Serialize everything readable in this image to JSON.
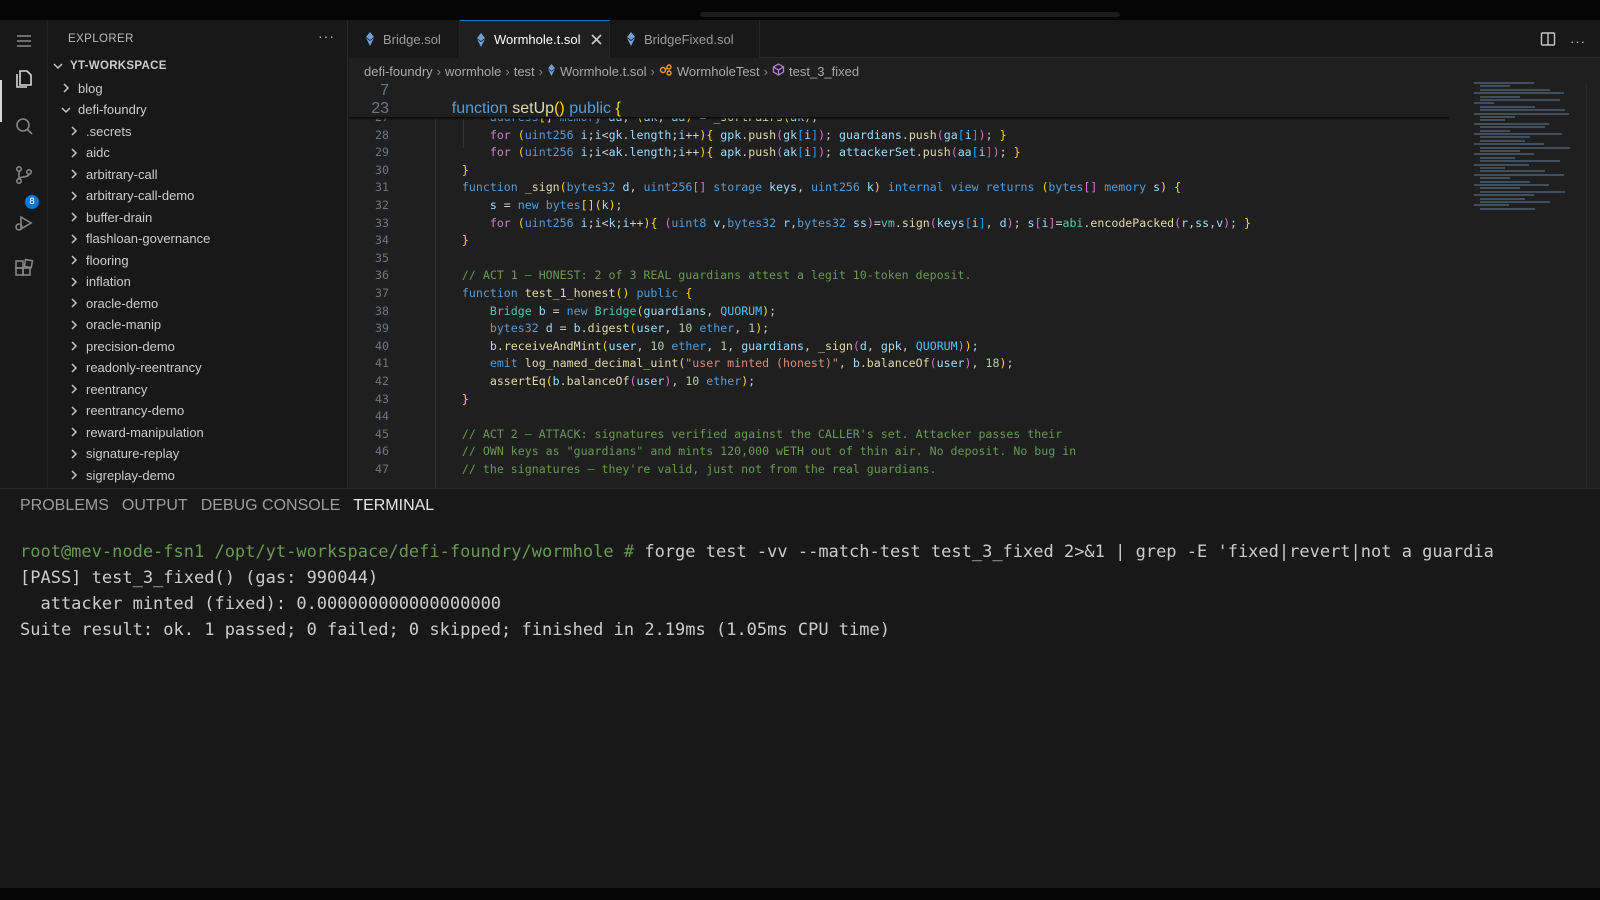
{
  "sidebar": {
    "title": "EXPLORER",
    "more": "···",
    "workspace": "YT-WORKSPACE",
    "items": [
      {
        "label": "blog",
        "indent": 1
      },
      {
        "label": "defi-foundry",
        "indent": 1,
        "open": true
      },
      {
        "label": ".secrets",
        "indent": 2
      },
      {
        "label": "aidc",
        "indent": 2
      },
      {
        "label": "arbitrary-call",
        "indent": 2
      },
      {
        "label": "arbitrary-call-demo",
        "indent": 2
      },
      {
        "label": "buffer-drain",
        "indent": 2
      },
      {
        "label": "flashloan-governance",
        "indent": 2
      },
      {
        "label": "flooring",
        "indent": 2
      },
      {
        "label": "inflation",
        "indent": 2
      },
      {
        "label": "oracle-demo",
        "indent": 2
      },
      {
        "label": "oracle-manip",
        "indent": 2
      },
      {
        "label": "precision-demo",
        "indent": 2
      },
      {
        "label": "readonly-reentrancy",
        "indent": 2
      },
      {
        "label": "reentrancy",
        "indent": 2
      },
      {
        "label": "reentrancy-demo",
        "indent": 2
      },
      {
        "label": "reward-manipulation",
        "indent": 2
      },
      {
        "label": "signature-replay",
        "indent": 2
      },
      {
        "label": "sigreplay-demo",
        "indent": 2
      }
    ]
  },
  "activity": {
    "scm_badge": "8"
  },
  "tabs": [
    {
      "label": "Bridge.sol",
      "active": false
    },
    {
      "label": "Wormhole.t.sol",
      "active": true
    },
    {
      "label": "BridgeFixed.sol",
      "active": false
    }
  ],
  "tab_actions": {
    "more": "···"
  },
  "breadcrumb": [
    "defi-foundry",
    "wormhole",
    "test",
    "Wormhole.t.sol",
    "WormholeTest",
    "test_3_fixed"
  ],
  "sticky_lines": [
    {
      "n": "7",
      "code": ""
    },
    {
      "n": "23",
      "code": "    function setUp() public {"
    }
  ],
  "code_lines": [
    {
      "n": "27",
      "code": "        address[] memory aa; (ak, aa) = _sortPairs(ak);"
    },
    {
      "n": "28",
      "code": "        for (uint256 i;i<gk.length;i++){ gpk.push(gk[i]); guardians.push(ga[i]); }"
    },
    {
      "n": "29",
      "code": "        for (uint256 i;i<ak.length;i++){ apk.push(ak[i]); attackerSet.push(aa[i]); }"
    },
    {
      "n": "30",
      "code": "    }"
    },
    {
      "n": "31",
      "code": "    function _sign(bytes32 d, uint256[] storage keys, uint256 k) internal view returns (bytes[] memory s) {"
    },
    {
      "n": "32",
      "code": "        s = new bytes[](k);"
    },
    {
      "n": "33",
      "code": "        for (uint256 i;i<k;i++){ (uint8 v,bytes32 r,bytes32 ss)=vm.sign(keys[i], d); s[i]=abi.encodePacked(r,ss,v); }"
    },
    {
      "n": "34",
      "code": "    }"
    },
    {
      "n": "35",
      "code": ""
    },
    {
      "n": "36",
      "code": "    // ACT 1 — HONEST: 2 of 3 REAL guardians attest a legit 10-token deposit."
    },
    {
      "n": "37",
      "code": "    function test_1_honest() public {"
    },
    {
      "n": "38",
      "code": "        Bridge b = new Bridge(guardians, QUORUM);"
    },
    {
      "n": "39",
      "code": "        bytes32 d = b.digest(user, 10 ether, 1);"
    },
    {
      "n": "40",
      "code": "        b.receiveAndMint(user, 10 ether, 1, guardians, _sign(d, gpk, QUORUM));"
    },
    {
      "n": "41",
      "code": "        emit log_named_decimal_uint(\"user minted (honest)\", b.balanceOf(user), 18);"
    },
    {
      "n": "42",
      "code": "        assertEq(b.balanceOf(user), 10 ether);"
    },
    {
      "n": "43",
      "code": "    }"
    },
    {
      "n": "44",
      "code": ""
    },
    {
      "n": "45",
      "code": "    // ACT 2 — ATTACK: signatures verified against the CALLER's set. Attacker passes their"
    },
    {
      "n": "46",
      "code": "    // OWN keys as \"guardians\" and mints 120,000 wETH out of thin air. No deposit. No bug in"
    },
    {
      "n": "47",
      "code": "    // the signatures — they're valid, just not from the real guardians."
    }
  ],
  "panel": {
    "tabs": [
      {
        "label": "PROBLEMS",
        "active": false
      },
      {
        "label": "OUTPUT",
        "active": false
      },
      {
        "label": "DEBUG CONSOLE",
        "active": false
      },
      {
        "label": "TERMINAL",
        "active": true
      }
    ],
    "terminal": {
      "prompt": "root@mev-node-fsn1 /opt/yt-workspace/defi-foundry/wormhole #",
      "command": " forge test -vv --match-test test_3_fixed 2>&1 | grep -E 'fixed|revert|not a guardia",
      "output": [
        "[PASS] test_3_fixed() (gas: 990044)",
        "  attacker minted (fixed): 0.000000000000000000",
        "Suite result: ok. 1 passed; 0 failed; 0 skipped; finished in 2.19ms (1.05ms CPU time)"
      ]
    }
  }
}
